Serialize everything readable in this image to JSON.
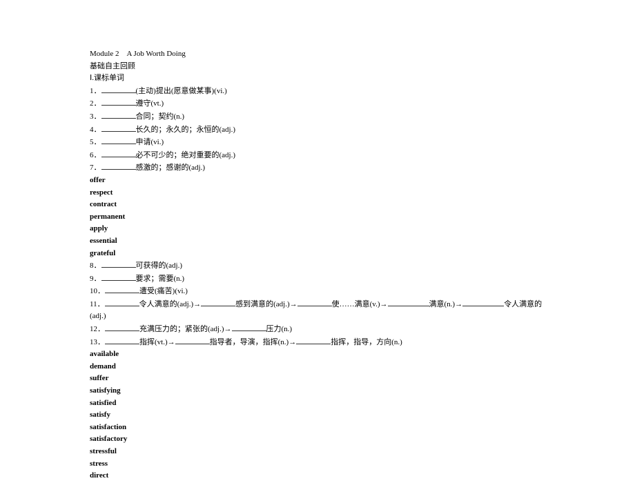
{
  "title": "Module 2　A Job Worth Doing",
  "subtitle": "基础自主回顾",
  "section1": "Ⅰ.课标单词",
  "items1": [
    {
      "num": "1．",
      "text": "(主动)提出(愿意做某事)(vi.)"
    },
    {
      "num": "2．",
      "text": "遵守(vt.)"
    },
    {
      "num": "3．",
      "text": "合同；契约(n.)"
    },
    {
      "num": "4．",
      "text": "长久的；永久的；永恒的(adj.)"
    },
    {
      "num": "5．",
      "text": "申请(vi.)"
    },
    {
      "num": "6．",
      "text": "必不可少的；绝对重要的(adj.)"
    },
    {
      "num": "7．",
      "text": "感激的；感谢的(adj.)"
    }
  ],
  "answers1": [
    "offer",
    "respect",
    "contract",
    "permanent",
    "apply",
    "essential",
    "grateful"
  ],
  "items2": [
    {
      "num": "8．",
      "text": "可获得的(adj.)"
    },
    {
      "num": "9．",
      "text": "要求；需要(n.)"
    },
    {
      "num": "10．",
      "text": "遭受(痛苦)(vi.)"
    }
  ],
  "item11": {
    "num": "11．",
    "parts": [
      "令人满意的(adj.)→",
      "感到满意的(adj.)→",
      "使……满意(v.)→",
      "满意(n.)→",
      "令人满意的(adj.)"
    ]
  },
  "item12": {
    "num": "12．",
    "parts": [
      "充满压力的；紧张的(adj.)→",
      "压力(n.)"
    ]
  },
  "item13": {
    "num": "13．",
    "parts": [
      "指挥(vt.)→",
      "指导者，导演，指挥(n.)→",
      "指挥，指导，方向(n.)"
    ]
  },
  "answers2": [
    "available",
    "demand",
    "suffer",
    "satisfying",
    "satisfied",
    "satisfy",
    "satisfaction",
    "satisfactory",
    "stressful",
    "stress",
    "direct"
  ]
}
